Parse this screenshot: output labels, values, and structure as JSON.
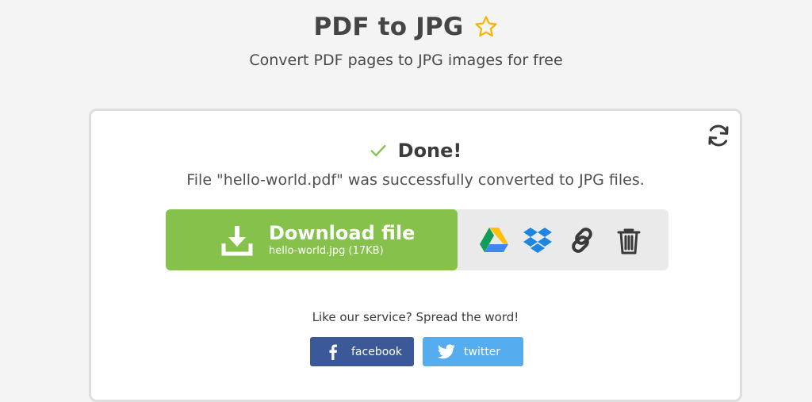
{
  "header": {
    "title": "PDF to JPG",
    "subtitle": "Convert PDF pages to JPG images for free",
    "favorite_icon": "star-outline-icon"
  },
  "result": {
    "status": "Done!",
    "message": "File \"hello-world.pdf\" was successfully converted to JPG files.",
    "refresh_icon": "refresh-icon"
  },
  "download": {
    "label": "Download file",
    "filename": "hello-world.jpg (17KB)"
  },
  "share_actions": [
    {
      "name": "google-drive",
      "icon": "google-drive-icon"
    },
    {
      "name": "dropbox",
      "icon": "dropbox-icon"
    },
    {
      "name": "link",
      "icon": "link-icon"
    },
    {
      "name": "delete",
      "icon": "trash-icon"
    }
  ],
  "social": {
    "prompt": "Like our service? Spread the word!",
    "facebook_label": "facebook",
    "twitter_label": "twitter"
  },
  "colors": {
    "background": "#f4f4f4",
    "accent_green": "#86c24b",
    "star_yellow": "#f4b400",
    "facebook_blue": "#3b5998",
    "twitter_blue": "#55acee"
  }
}
